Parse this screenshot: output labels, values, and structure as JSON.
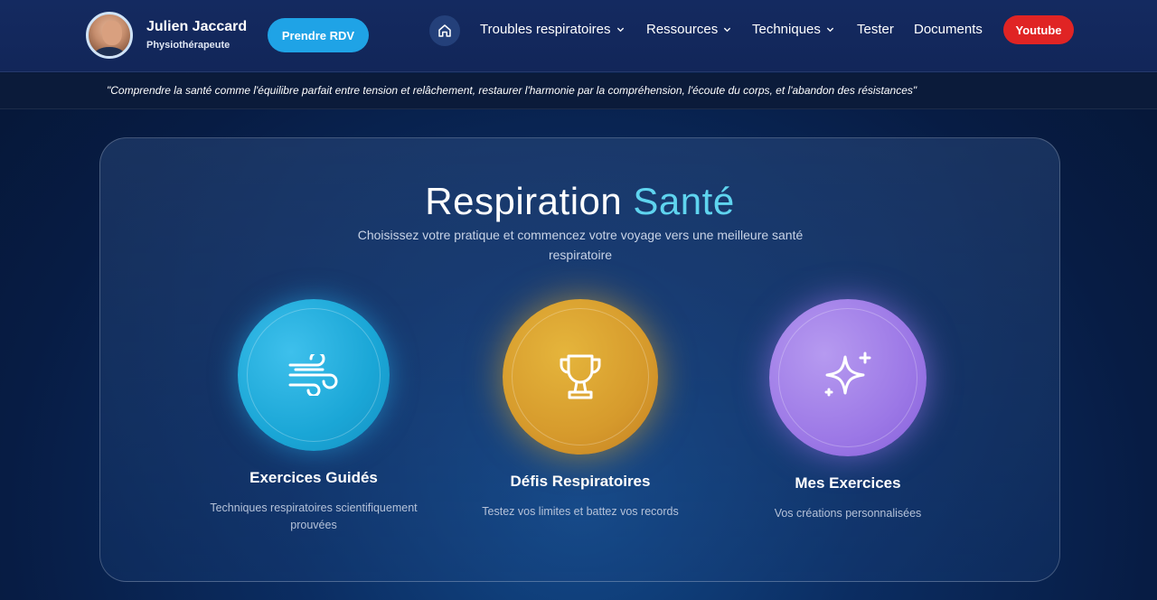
{
  "header": {
    "name": "Julien Jaccard",
    "role": "Physiothérapeute",
    "cta": "Prendre RDV",
    "nav": [
      {
        "label": "Troubles respiratoires",
        "has_dropdown": true
      },
      {
        "label": "Ressources",
        "has_dropdown": true
      },
      {
        "label": "Techniques",
        "has_dropdown": true
      },
      {
        "label": "Tester",
        "has_dropdown": false
      },
      {
        "label": "Documents",
        "has_dropdown": false
      }
    ],
    "youtube": "Youtube",
    "home_icon": "home-icon"
  },
  "quote": "\"Comprendre la santé comme l'équilibre parfait entre tension et relâchement, restaurer l'harmonie par la compréhension, l'écoute du corps, et l'abandon des résistances\"",
  "main": {
    "title_part1": "Respiration",
    "title_part2": "Santé",
    "subtitle": "Choisissez votre pratique et commencez votre voyage vers une meilleure santé respiratoire",
    "features": [
      {
        "title": "Exercices Guidés",
        "description": "Techniques respiratoires scientifiquement prouvées",
        "icon": "wind-icon",
        "color": "#1aa6d6"
      },
      {
        "title": "Défis Respiratoires",
        "description": "Testez vos limites et battez vos records",
        "icon": "trophy-icon",
        "color": "#d69a2c"
      },
      {
        "title": "Mes Exercices",
        "description": "Vos créations personnalisées",
        "icon": "sparkle-icon",
        "color": "#9c78e6"
      }
    ]
  },
  "colors": {
    "accent": "#5fd4ef",
    "cta_blue": "#1fa3e6",
    "youtube_red": "#e02424"
  }
}
